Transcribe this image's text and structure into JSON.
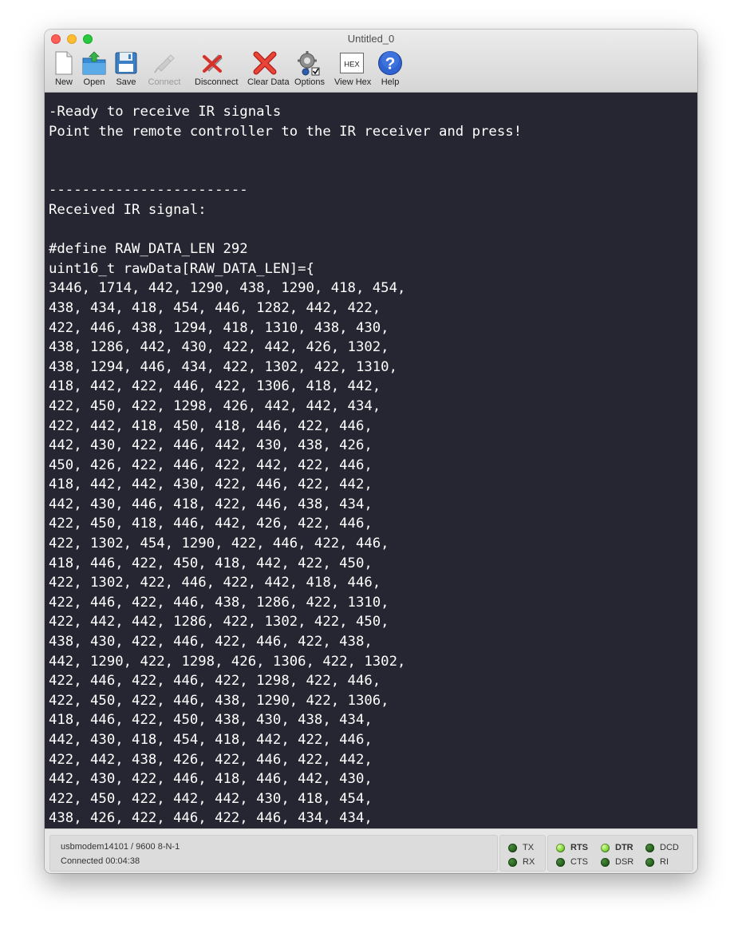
{
  "window": {
    "title": "Untitled_0"
  },
  "toolbar": {
    "items": [
      {
        "label": "New",
        "icon": "new-document-icon",
        "enabled": true
      },
      {
        "label": "Open",
        "icon": "open-folder-icon",
        "enabled": true
      },
      {
        "label": "Save",
        "icon": "save-floppy-icon",
        "enabled": true
      },
      {
        "label": "Connect",
        "icon": "usb-plug-icon",
        "enabled": false
      },
      {
        "label": "Disconnect",
        "icon": "disconnect-plug-icon",
        "enabled": true
      },
      {
        "label": "Clear Data",
        "icon": "red-x-icon",
        "enabled": true
      },
      {
        "label": "Options",
        "icon": "gear-options-icon",
        "enabled": true
      },
      {
        "label": "View Hex",
        "icon": "hex-box-icon",
        "enabled": true,
        "icon_text": "HEX"
      },
      {
        "label": "Help",
        "icon": "help-question-icon",
        "enabled": true,
        "icon_text": "?"
      }
    ]
  },
  "terminal": {
    "background": "#252631",
    "text_color": "#ffffff",
    "content": "-Ready to receive IR signals\nPoint the remote controller to the IR receiver and press!\n\n\n------------------------\nReceived IR signal:\n\n#define RAW_DATA_LEN 292\nuint16_t rawData[RAW_DATA_LEN]={\n3446, 1714, 442, 1290, 438, 1290, 418, 454,\n438, 434, 418, 454, 446, 1282, 442, 422,\n422, 446, 438, 1294, 418, 1310, 438, 430,\n438, 1286, 442, 430, 422, 442, 426, 1302,\n438, 1294, 446, 434, 422, 1302, 422, 1310,\n418, 442, 422, 446, 422, 1306, 418, 442,\n422, 450, 422, 1298, 426, 442, 442, 434,\n422, 442, 418, 450, 418, 446, 422, 446,\n442, 430, 422, 446, 442, 430, 438, 426,\n450, 426, 422, 446, 422, 442, 422, 446,\n418, 442, 442, 430, 422, 446, 422, 442,\n442, 430, 446, 418, 422, 446, 438, 434,\n422, 450, 418, 446, 442, 426, 422, 446,\n422, 1302, 454, 1290, 422, 446, 422, 446,\n418, 446, 422, 450, 418, 442, 422, 450,\n422, 1302, 422, 446, 422, 442, 418, 446,\n422, 446, 422, 446, 438, 1286, 422, 1310,\n422, 442, 442, 1286, 422, 1302, 422, 450,\n438, 430, 422, 446, 422, 446, 422, 438,\n442, 1290, 422, 1298, 426, 1306, 422, 1302,\n422, 446, 422, 446, 422, 1298, 422, 446,\n422, 450, 422, 446, 438, 1290, 422, 1306,\n418, 446, 422, 450, 438, 430, 438, 434,\n442, 430, 418, 454, 418, 442, 422, 446,\n422, 442, 438, 426, 422, 446, 422, 442,\n442, 430, 422, 446, 418, 446, 442, 430,\n422, 450, 422, 442, 442, 430, 418, 454,\n438, 426, 422, 446, 422, 446, 434, 434,"
  },
  "status": {
    "port": "usbmodem14101 / 9600 8-N-1",
    "connection": "Connected 00:04:38",
    "leds": [
      {
        "label": "TX",
        "on": false,
        "bold": false
      },
      {
        "label": "RX",
        "on": false,
        "bold": false
      },
      {
        "label": "RTS",
        "on": true,
        "bold": true
      },
      {
        "label": "CTS",
        "on": false,
        "bold": false
      },
      {
        "label": "DTR",
        "on": true,
        "bold": true
      },
      {
        "label": "DSR",
        "on": false,
        "bold": false
      },
      {
        "label": "DCD",
        "on": false,
        "bold": false
      },
      {
        "label": "RI",
        "on": false,
        "bold": false
      }
    ]
  }
}
